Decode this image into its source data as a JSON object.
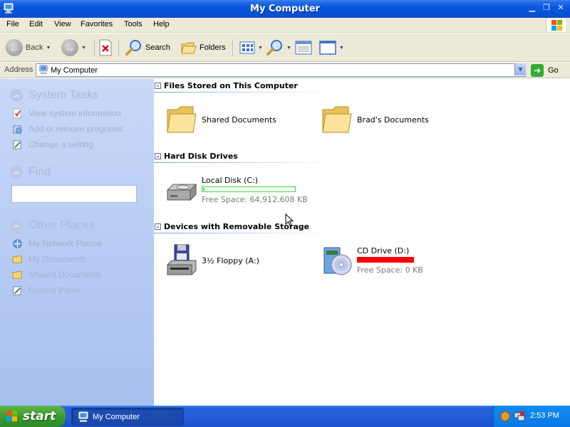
{
  "window": {
    "title": "My Computer"
  },
  "menu": {
    "items": [
      "File",
      "Edit",
      "View",
      "Favorites",
      "Tools",
      "Help"
    ]
  },
  "toolbar": {
    "back_label": "Back",
    "search_label": "Search",
    "folders_label": "Folders"
  },
  "address": {
    "label": "Address",
    "value": "My Computer",
    "go_label": "Go"
  },
  "left_pane": {
    "system_tasks": {
      "title": "System Tasks",
      "items": [
        "View system information",
        "Add or remove programs",
        "Change a setting"
      ]
    },
    "find": {
      "title": "Find",
      "value": ""
    },
    "other_places": {
      "title": "Other Places",
      "items": [
        "My Network Places",
        "My Documents",
        "Shared Documents",
        "Control Panel"
      ]
    }
  },
  "groups": {
    "files": {
      "title": "Files Stored on This Computer",
      "items": [
        {
          "name": "Shared Documents",
          "icon": "folder-icon"
        },
        {
          "name": "Brad's Documents",
          "icon": "folder-icon"
        }
      ]
    },
    "hard_disks": {
      "title": "Hard Disk Drives",
      "items": [
        {
          "name": "Local Disk (C:)",
          "free": "Free Space: 64,912,608 KB",
          "free_fraction": 0.01,
          "icon": "hard-disk-icon"
        }
      ]
    },
    "removable": {
      "title": "Devices with Removable Storage",
      "items": [
        {
          "name": "3½ Floppy (A:)",
          "icon": "floppy-drive-icon"
        },
        {
          "name": "CD Drive (D:)",
          "free": "Free Space: 0 KB",
          "free_fraction": 0,
          "icon": "cd-drive-icon"
        }
      ]
    }
  },
  "taskbar": {
    "start_label": "start",
    "task_label": "My Computer",
    "clock": "2:53 PM"
  },
  "colors": {
    "titlebar": "#0a58e0",
    "left_pane": "#a8c0f0",
    "disk_free_bar": "#3bd43b",
    "cd_bar": "#ff0000"
  }
}
